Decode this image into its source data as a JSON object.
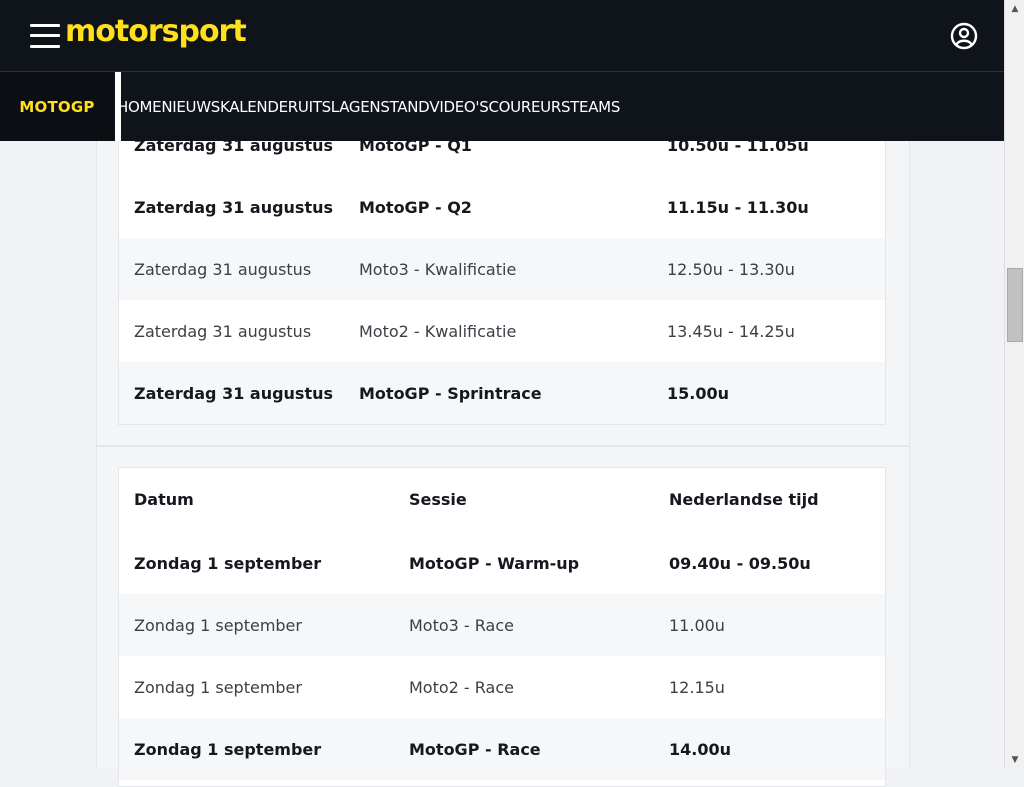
{
  "header": {
    "logo": "motorsport",
    "section": "MOTOGP",
    "nav_links": [
      "HOME",
      "NIEUWS",
      "KALENDER",
      "UITSLAGEN",
      "STAND",
      "VIDEO'S",
      "COUREURS",
      "TEAMS"
    ]
  },
  "icons": {
    "menu": "hamburger-menu-icon",
    "account": "user-account-icon"
  },
  "colors": {
    "brand_yellow": "#ffe01b",
    "header_bg": "#0f131a"
  },
  "schedule_saturday": {
    "rows": [
      {
        "datum": "Zaterdag 31 augustus",
        "sessie": "MotoGP - Q1",
        "tijd": "10.50u - 11.05u",
        "bold": true
      },
      {
        "datum": "Zaterdag 31 augustus",
        "sessie": "MotoGP - Q2",
        "tijd": "11.15u - 11.30u",
        "bold": true
      },
      {
        "datum": "Zaterdag 31 augustus",
        "sessie": "Moto3 - Kwalificatie",
        "tijd": "12.50u - 13.30u",
        "bold": false
      },
      {
        "datum": "Zaterdag 31 augustus",
        "sessie": "Moto2 - Kwalificatie",
        "tijd": "13.45u - 14.25u",
        "bold": false
      },
      {
        "datum": "Zaterdag 31 augustus",
        "sessie": "MotoGP - Sprintrace",
        "tijd": "15.00u",
        "bold": true
      }
    ]
  },
  "schedule_sunday": {
    "headers": {
      "datum": "Datum",
      "sessie": "Sessie",
      "tijd": "Nederlandse tijd"
    },
    "rows": [
      {
        "datum": "Zondag 1 september",
        "sessie": "MotoGP - Warm-up",
        "tijd": "09.40u - 09.50u",
        "bold": true
      },
      {
        "datum": "Zondag 1 september",
        "sessie": "Moto3 - Race",
        "tijd": "11.00u",
        "bold": false
      },
      {
        "datum": "Zondag 1 september",
        "sessie": "Moto2 - Race",
        "tijd": "12.15u",
        "bold": false
      },
      {
        "datum": "Zondag 1 september",
        "sessie": "MotoGP - Race",
        "tijd": "14.00u",
        "bold": true
      }
    ]
  }
}
